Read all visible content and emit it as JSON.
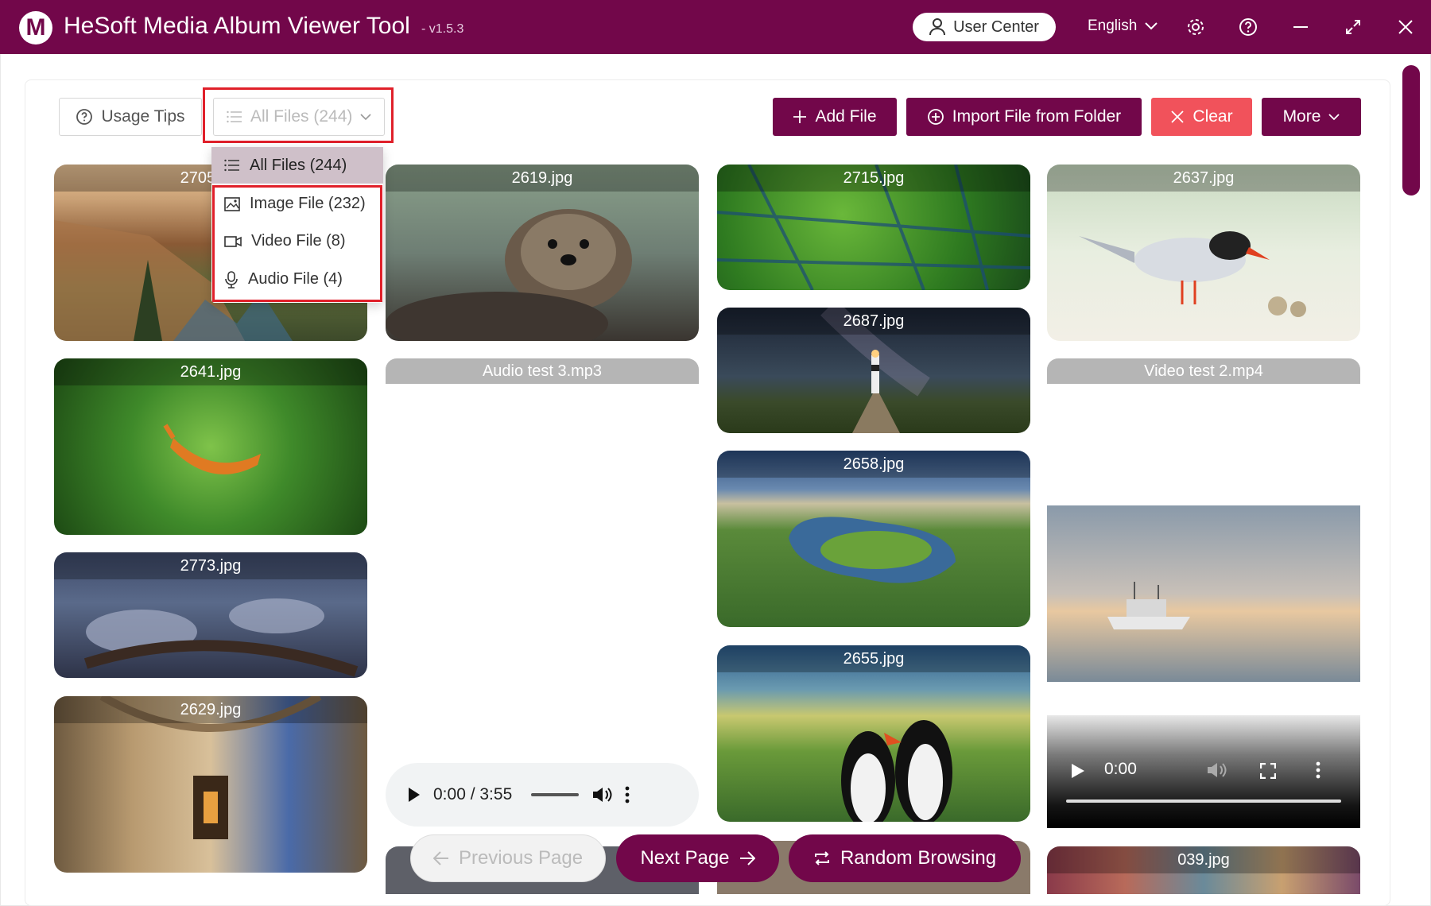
{
  "titlebar": {
    "logo_letter": "M",
    "app_name": "HeSoft Media Album Viewer Tool",
    "version": "- v1.5.3",
    "user_center_label": "User Center",
    "language_label": "English"
  },
  "toolbar": {
    "usage_tips_label": "Usage Tips",
    "filter_selected": "All Files (244)",
    "add_file_label": "Add File",
    "import_folder_label": "Import File from Folder",
    "clear_label": "Clear",
    "more_label": "More"
  },
  "filter_dropdown": {
    "items": [
      {
        "label": "All Files (244)",
        "icon": "list-icon"
      },
      {
        "label": "Image File (232)",
        "icon": "image-icon"
      },
      {
        "label": "Video File (8)",
        "icon": "video-icon"
      },
      {
        "label": "Audio File (4)",
        "icon": "microphone-icon"
      }
    ]
  },
  "gallery": {
    "col1": [
      "2705.jpg",
      "2641.jpg",
      "2773.jpg",
      "2629.jpg"
    ],
    "col2": [
      "2619.jpg",
      "Audio test 3.mp3"
    ],
    "col3": [
      "2715.jpg",
      "2687.jpg",
      "2658.jpg",
      "2655.jpg"
    ],
    "col4": [
      "2637.jpg",
      "Video test 2.mp4",
      "039.jpg"
    ]
  },
  "audio_player": {
    "time": "0:00 / 3:55"
  },
  "video_player": {
    "time": "0:00"
  },
  "pagination": {
    "prev_label": "Previous Page",
    "next_label": "Next Page",
    "random_label": "Random Browsing"
  },
  "colors": {
    "brand": "#72074a",
    "danger": "#f1525b",
    "highlight": "#e0202a"
  }
}
